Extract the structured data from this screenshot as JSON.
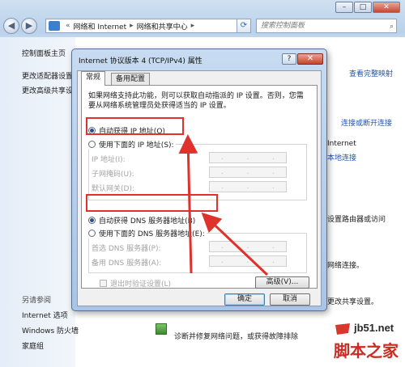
{
  "window": {
    "address_root": "网络和 Internet",
    "address_leaf": "网络和共享中心",
    "search_placeholder": "搜索控制面板"
  },
  "left_pane": {
    "home": "控制面板主页",
    "items": [
      "更改适配器设置",
      "更改高级共享设置"
    ],
    "see_also_heading": "另请参阅",
    "see_also": [
      "Internet 选项",
      "Windows 防火墙",
      "家庭组"
    ]
  },
  "right_pane": {
    "view_map": "查看完整映射",
    "connect": "连接或断开连接",
    "internet": "Internet",
    "local_conn": "本地连接",
    "router_text": "设置路由器或访问",
    "network_conn": "网络连接。",
    "sharing_text": "更改共享设置。",
    "troubleshoot": "诊断并修复网络问题，或获得故障排除"
  },
  "dialog": {
    "title": "Internet 协议版本 4 (TCP/IPv4) 属性",
    "help": "?",
    "close": "✕",
    "tabs": [
      "常规",
      "备用配置"
    ],
    "description": "如果网络支持此功能，则可以获取自动指派的 IP 设置。否则，您需要从网络系统管理员处获得适当的 IP 设置。",
    "ip_auto": "自动获得 IP 地址(O)",
    "ip_manual": "使用下面的 IP 地址(S):",
    "ip_fields": [
      "IP 地址(I):",
      "子网掩码(U):",
      "默认网关(D):"
    ],
    "dns_auto": "自动获得 DNS 服务器地址(B)",
    "dns_manual": "使用下面的 DNS 服务器地址(E):",
    "dns_fields": [
      "首选 DNS 服务器(P):",
      "备用 DNS 服务器(A):"
    ],
    "validate": "退出时验证设置(L)",
    "advanced": "高级(V)...",
    "ok": "确定",
    "cancel": "取消",
    "selected_ip_mode": "auto",
    "selected_dns_mode": "auto"
  },
  "watermark": {
    "url": "jb51.net",
    "name": "脚本之家"
  },
  "colors": {
    "highlight": "#e0322d",
    "link": "#1f55a8"
  }
}
